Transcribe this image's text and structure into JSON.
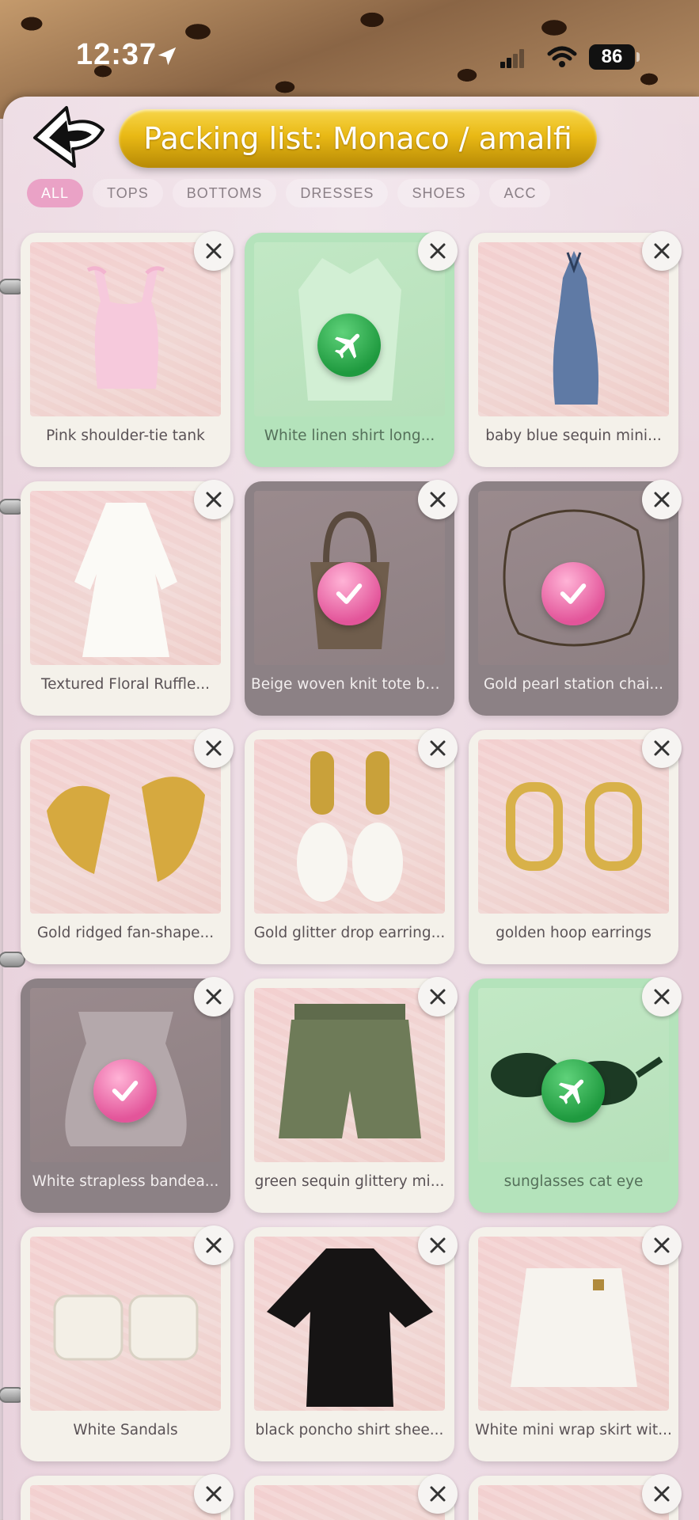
{
  "status_bar": {
    "time": "12:37",
    "battery": "86"
  },
  "header": {
    "title": "Packing list: Monaco / amalfi",
    "back_icon": "back-arrow-icon"
  },
  "tabs": [
    {
      "label": "ALL",
      "active": true
    },
    {
      "label": "TOPS",
      "active": false
    },
    {
      "label": "BOTTOMS",
      "active": false
    },
    {
      "label": "DRESSES",
      "active": false
    },
    {
      "label": "SHOES",
      "active": false
    },
    {
      "label": "ACC",
      "active": false
    }
  ],
  "items": [
    {
      "label": "Pink shoulder-tie tank",
      "state": "normal",
      "image": "pink-tank"
    },
    {
      "label": "White linen shirt long...",
      "state": "flight",
      "image": "linen-shirt"
    },
    {
      "label": "baby blue sequin mini...",
      "state": "normal",
      "image": "denim-dress"
    },
    {
      "label": "Textured Floral Ruffle...",
      "state": "normal",
      "image": "white-dress"
    },
    {
      "label": "Beige woven knit tote ba...",
      "state": "packed",
      "image": "tote-bag"
    },
    {
      "label": "Gold pearl station chai...",
      "state": "packed",
      "image": "bracelet"
    },
    {
      "label": "Gold ridged fan-shape...",
      "state": "normal",
      "image": "fan-earrings"
    },
    {
      "label": "Gold glitter drop earring...",
      "state": "normal",
      "image": "pearl-earrings"
    },
    {
      "label": "golden hoop earrings",
      "state": "normal",
      "image": "hoop-earrings"
    },
    {
      "label": "White strapless bandea...",
      "state": "packed",
      "image": "bandeau-top"
    },
    {
      "label": "green sequin glittery mi...",
      "state": "normal",
      "image": "sequin-shorts"
    },
    {
      "label": "sunglasses cat eye",
      "state": "flight",
      "image": "sunglasses"
    },
    {
      "label": "White Sandals",
      "state": "normal",
      "image": "sandals"
    },
    {
      "label": "black poncho shirt shee...",
      "state": "normal",
      "image": "poncho"
    },
    {
      "label": "White mini wrap skirt wit...",
      "state": "normal",
      "image": "skort"
    }
  ],
  "colors": {
    "accent_pink": "#eaa2c6",
    "flight_green": "#b4e3bb",
    "packed_gray": "#8c8185",
    "title_gold": "#e9b915"
  }
}
